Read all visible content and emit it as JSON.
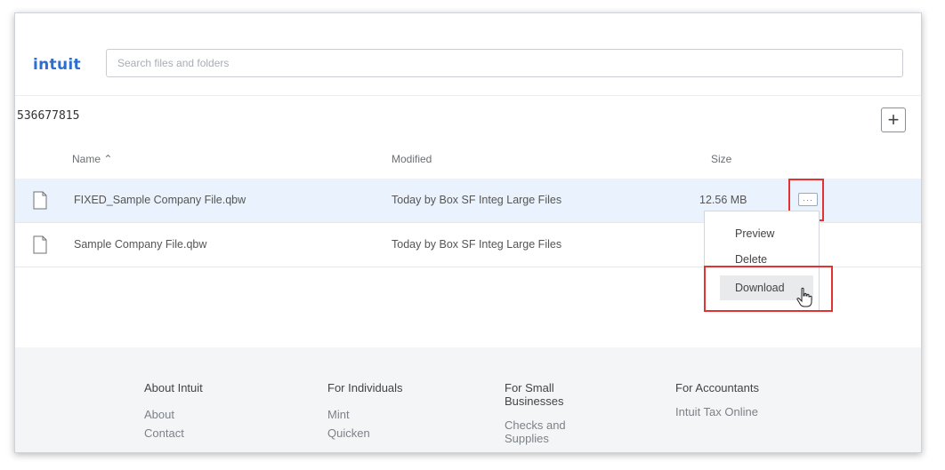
{
  "header": {
    "logo": "intuit",
    "search_placeholder": "Search files and folders"
  },
  "folder": {
    "title": "536677815",
    "add_button": "+"
  },
  "columns": {
    "name": "Name ⌃",
    "modified": "Modified",
    "size": "Size"
  },
  "files": [
    {
      "name": "FIXED_Sample Company File.qbw",
      "modified": "Today by Box SF Integ Large Files",
      "size": "12.56 MB",
      "selected": true
    },
    {
      "name": "Sample Company File.qbw",
      "modified": "Today by Box SF Integ Large Files",
      "size": ""
    }
  ],
  "row_actions": {
    "more_label": "···"
  },
  "context_menu": {
    "items": [
      "Preview",
      "Delete",
      "Download"
    ],
    "hovered": "Download"
  },
  "footer": {
    "columns": [
      {
        "heading": "About Intuit",
        "links": [
          "About",
          "Contact"
        ]
      },
      {
        "heading": "For Individuals",
        "links": [
          "Mint",
          "Quicken"
        ]
      },
      {
        "heading": "For Small Businesses",
        "links": [
          "Checks and Supplies"
        ]
      },
      {
        "heading": "For Accountants",
        "links": [
          "Intuit Tax Online"
        ]
      }
    ]
  },
  "colors": {
    "brand": "#2c6fcf",
    "highlight_red": "#e23232",
    "selected_row": "#eaf3fd"
  }
}
